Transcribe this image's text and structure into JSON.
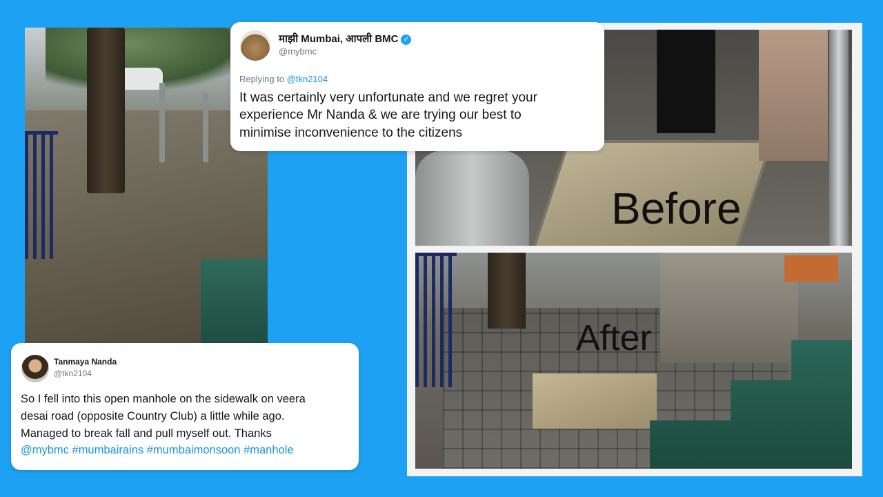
{
  "tweet_bmc": {
    "display_name": "माझी Mumbai, आपली BMC",
    "handle": "@mybmc",
    "replying_prefix": "Replying to ",
    "replying_handle": "@tkn2104",
    "text_lines": [
      "It was certainly very unfortunate and we regret your",
      "experience Mr Nanda & we are trying our best to",
      "minimise inconvenience to the citizens"
    ],
    "verified_icon": "verified-badge-icon"
  },
  "tweet_nanda": {
    "display_name": "Tanmaya Nanda",
    "handle": "@tkn2104",
    "text_lines": [
      "So I fell into this open manhole on the sidewalk on veera",
      "desai road (opposite Country Club) a little while ago.",
      "Managed to break fall and pull myself out. Thanks"
    ],
    "links": [
      "@mybmc",
      "#mumbairains",
      "#mumbaimonsoon",
      "#manhole"
    ]
  },
  "collage": {
    "before_label": "Before",
    "after_label": "After"
  },
  "colors": {
    "background": "#1da1f2",
    "link": "#1b95e0",
    "text": "#14171a",
    "handle": "#657786"
  }
}
